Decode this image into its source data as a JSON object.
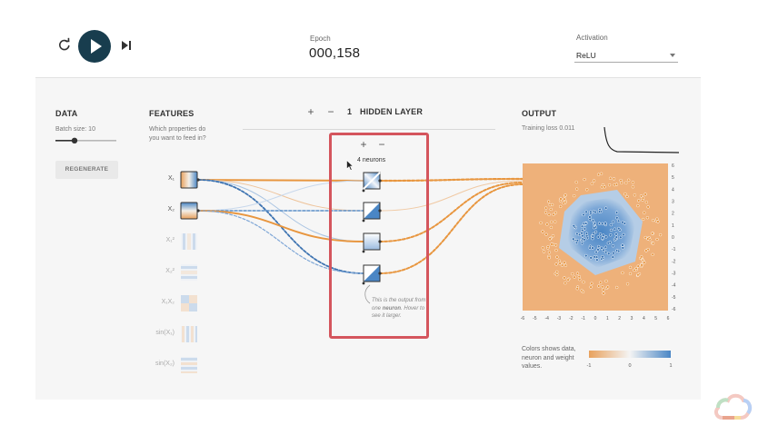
{
  "topbar": {
    "epoch_label": "Epoch",
    "epoch_value": "000,158",
    "activation_label": "Activation",
    "activation_value": "ReLU",
    "icons": {
      "reset": "reset-icon",
      "play": "play-icon",
      "step": "step-forward-icon"
    }
  },
  "data_panel": {
    "heading": "DATA",
    "batch_size_label": "Batch size:  10",
    "batch_size": 10,
    "regenerate_label": "REGENERATE"
  },
  "features_panel": {
    "heading": "FEATURES",
    "question": "Which properties do you want to feed in?",
    "features": [
      {
        "label": "X₁",
        "active": true
      },
      {
        "label": "X₂",
        "active": true
      },
      {
        "label": "X₁²",
        "active": false
      },
      {
        "label": "X₂²",
        "active": false
      },
      {
        "label": "X₁X₂",
        "active": false
      },
      {
        "label": "sin(X₁)",
        "active": false
      },
      {
        "label": "sin(X₂)",
        "active": false
      }
    ]
  },
  "network": {
    "add_layer_label": "+",
    "remove_layer_label": "−",
    "layer_count": "1",
    "layers_label": "HIDDEN LAYER",
    "add_neuron_label": "+",
    "remove_neuron_label": "−",
    "neurons_label": "4 neurons",
    "neuron_note_prefix": "This is the output from one ",
    "neuron_note_bold": "neuron",
    "neuron_note_suffix": ". Hover to see it larger."
  },
  "output_panel": {
    "heading": "OUTPUT",
    "training_loss_label": "Training loss 0.011",
    "y_ticks": [
      "6",
      "5",
      "4",
      "3",
      "2",
      "1",
      "0",
      "-1",
      "-2",
      "-3",
      "-4",
      "-5",
      "-6"
    ],
    "x_ticks": [
      "-6",
      "-5",
      "-4",
      "-3",
      "-2",
      "-1",
      "0",
      "1",
      "2",
      "3",
      "4",
      "5",
      "6"
    ],
    "legend_text": "Colors shows data, neuron and weight values.",
    "legend_ticks": [
      "-1",
      "0",
      "1"
    ]
  },
  "colors": {
    "orange": "#e8a15d",
    "blue": "#4a86c5",
    "highlight": "#d4555d",
    "play_button": "#183d4e"
  }
}
